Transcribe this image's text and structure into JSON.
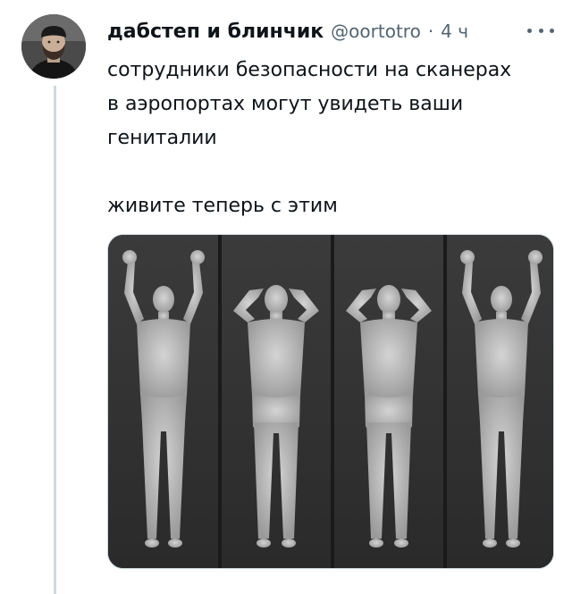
{
  "tweet": {
    "display_name": "дабстеп и блинчик",
    "handle": "@oortotro",
    "separator": "·",
    "time": "4 ч",
    "text_lines": [
      "сотрудники безопасности на сканерах",
      "в аэропортах могут увидеть ваши",
      "гениталии"
    ],
    "text_after": "живите теперь с этим"
  },
  "icons": {
    "more": "more-horizontal-icon",
    "avatar": "user-avatar-photo"
  },
  "colors": {
    "text": "#0f1419",
    "secondary": "#536471",
    "thread_line": "#cfd9de"
  }
}
